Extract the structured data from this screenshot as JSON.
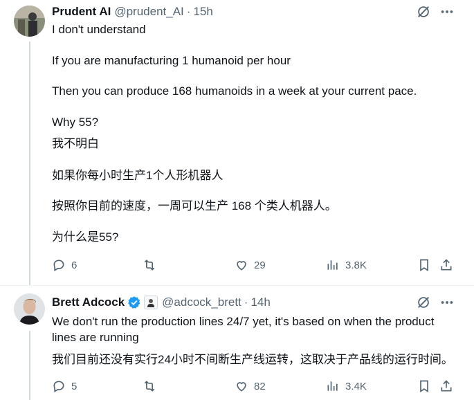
{
  "tweets": [
    {
      "name": "Prudent AI",
      "handle": "@prudent_AI",
      "time": "15h",
      "lines": [
        "I don't understand",
        "If you are manufacturing 1 humanoid per hour",
        "Then you can produce 168 humanoids in a week at your current pace.",
        "Why 55?",
        "我不明白",
        "如果你每小时生产1个人形机器人",
        "按照你目前的速度，一周可以生产 168 个类人机器人。",
        "为什么是55?"
      ],
      "stats": {
        "replies": "6",
        "retweets": "",
        "likes": "29",
        "views": "3.8K"
      }
    },
    {
      "name": "Brett Adcock",
      "handle": "@adcock_brett",
      "time": "14h",
      "verified": true,
      "lines": [
        "We don't run the production lines 24/7 yet, it's based on when the product",
        "lines are running",
        "我们目前还没有实行24小时不间断生产线运转，这取决于产品线的运行时间。"
      ],
      "stats": {
        "replies": "5",
        "retweets": "",
        "likes": "82",
        "views": "3.4K"
      }
    }
  ],
  "separator": "·",
  "colors": {
    "muted": "#536471",
    "verified": "#1d9bf0",
    "line": "#cfd9de"
  }
}
